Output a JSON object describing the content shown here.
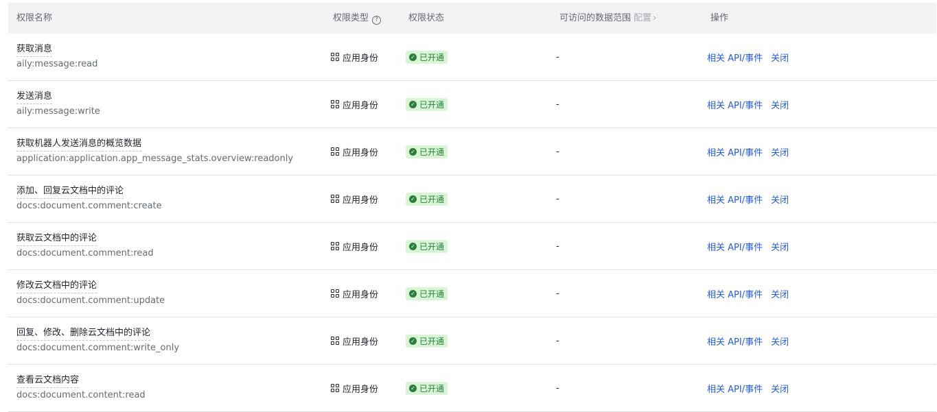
{
  "header": {
    "name": "权限名称",
    "type": "权限类型",
    "status": "权限状态",
    "scope": "可访问的数据范围",
    "scope_config": "配置",
    "ops": "操作"
  },
  "rows": [
    {
      "title": "获取消息",
      "key": "aily:message:read",
      "type": "应用身份",
      "status": "已开通",
      "scope": "-",
      "op_api": "相关 API/事件",
      "op_close": "关闭"
    },
    {
      "title": "发送消息",
      "key": "aily:message:write",
      "type": "应用身份",
      "status": "已开通",
      "scope": "-",
      "op_api": "相关 API/事件",
      "op_close": "关闭"
    },
    {
      "title": "获取机器人发送消息的概览数据",
      "key": "application:application.app_message_stats.overview:readonly",
      "type": "应用身份",
      "status": "已开通",
      "scope": "-",
      "op_api": "相关 API/事件",
      "op_close": "关闭"
    },
    {
      "title": "添加、回复云文档中的评论",
      "key": "docs:document.comment:create",
      "type": "应用身份",
      "status": "已开通",
      "scope": "-",
      "op_api": "相关 API/事件",
      "op_close": "关闭"
    },
    {
      "title": "获取云文档中的评论",
      "key": "docs:document.comment:read",
      "type": "应用身份",
      "status": "已开通",
      "scope": "-",
      "op_api": "相关 API/事件",
      "op_close": "关闭"
    },
    {
      "title": "修改云文档中的评论",
      "key": "docs:document.comment:update",
      "type": "应用身份",
      "status": "已开通",
      "scope": "-",
      "op_api": "相关 API/事件",
      "op_close": "关闭"
    },
    {
      "title": "回复、修改、删除云文档中的评论",
      "key": "docs:document.comment:write_only",
      "type": "应用身份",
      "status": "已开通",
      "scope": "-",
      "op_api": "相关 API/事件",
      "op_close": "关闭"
    },
    {
      "title": "查看云文档内容",
      "key": "docs:document.content:read",
      "type": "应用身份",
      "status": "已开通",
      "scope": "-",
      "op_api": "相关 API/事件",
      "op_close": "关闭"
    }
  ],
  "icons": {
    "help": "help-circle-icon",
    "chevron": "chevron-right-icon",
    "type": "grid-icon",
    "status": "check-circle-icon"
  },
  "colors": {
    "link": "#245bdb",
    "badge_bg": "#d9f5d6",
    "badge_text": "#24823a",
    "header_bg": "#f2f3f5"
  }
}
